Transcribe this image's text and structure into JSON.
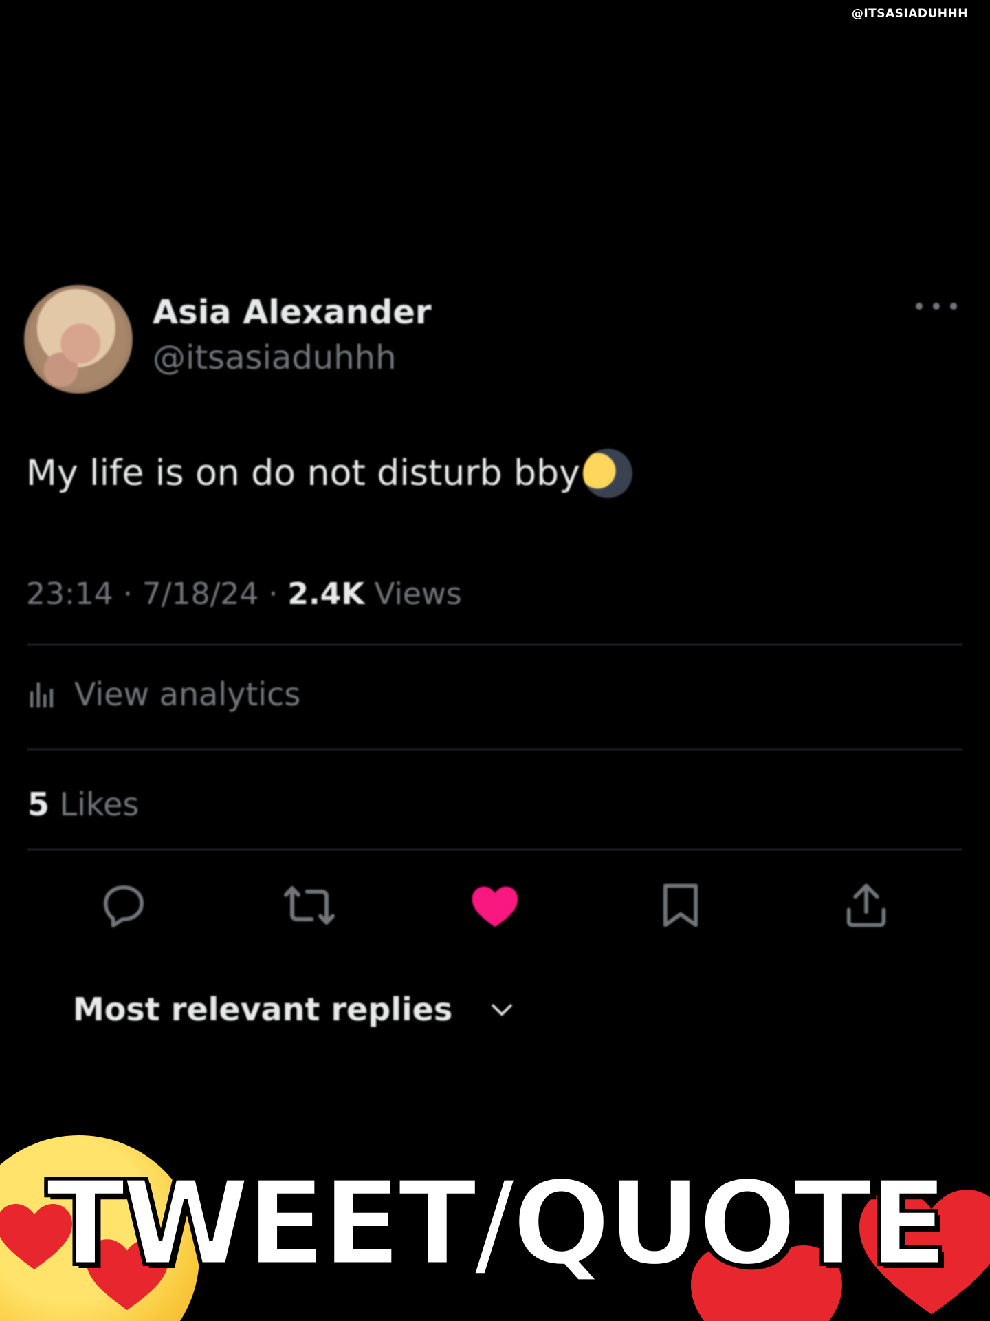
{
  "watermark": "@ITSASIADUHHH",
  "tweet": {
    "author_name": "Asia Alexander",
    "author_handle": "@itsasiaduhhh",
    "text": "My life is on do not disturb bby",
    "emoji": "first-quarter-moon-face",
    "time": "23:14",
    "date": "7/18/24",
    "views_count": "2.4K",
    "views_label": "Views",
    "analytics_label": "View analytics",
    "likes_count": "5",
    "likes_label": "Likes",
    "liked": true,
    "like_color": "#f91880"
  },
  "replies_sort": {
    "label": "Most relevant replies"
  },
  "overlay": {
    "title": "TWEET/QUOTE"
  }
}
